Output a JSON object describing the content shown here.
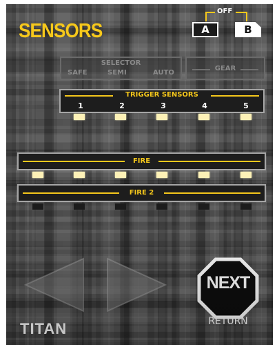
{
  "screen": {
    "title": "SENSORS",
    "brand": "TITAN"
  },
  "mode": {
    "off_label": "OFF",
    "a_label": "A",
    "b_label": "B",
    "selected": "B"
  },
  "selector": {
    "title": "SELECTOR",
    "options": [
      "SAFE",
      "SEMI",
      "AUTO"
    ],
    "enabled": false
  },
  "gear": {
    "label": "GEAR",
    "enabled": false
  },
  "trigger": {
    "label": "TRIGGER SENSORS",
    "numbers": [
      "1",
      "2",
      "3",
      "4",
      "5"
    ],
    "leds": [
      true,
      true,
      true,
      true,
      true
    ]
  },
  "fire": {
    "label": "FIRE",
    "leds": [
      true,
      true,
      true,
      true,
      true,
      true
    ]
  },
  "fire2": {
    "label": "FIRE 2",
    "leds": [
      false,
      false,
      false,
      false,
      false,
      false
    ]
  },
  "nav": {
    "prev_icon": "left-triangle-icon",
    "next_icon": "right-triangle-icon",
    "next_label": "NEXT",
    "return_label": "RETURN"
  },
  "colors": {
    "accent": "#f6c81b",
    "led_on": "#fdf1b7",
    "led_off": "#1c1c1c",
    "panel": "#1d1d1d",
    "border": "#a6a6a6"
  }
}
